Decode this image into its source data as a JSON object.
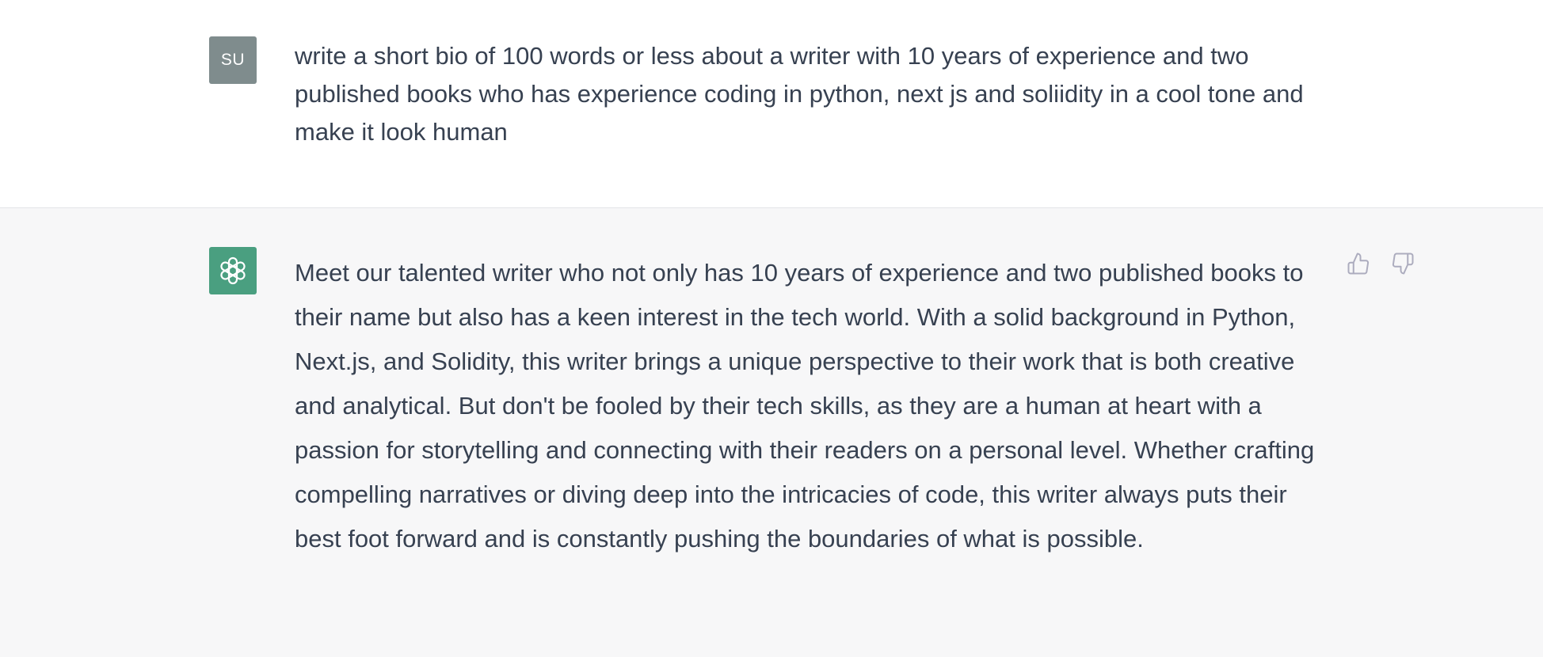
{
  "user_message": {
    "avatar_initials": "SU",
    "avatar_color": "#7f8c8d",
    "text": "write a short bio of 100 words or less about a writer with 10 years of experience and two published books who has experience coding in python, next js and soliidity in a cool tone and make it look human"
  },
  "assistant_message": {
    "avatar_icon": "openai-logo-icon",
    "avatar_color": "#4a9f80",
    "text": "Meet our talented writer who not only has 10 years of experience and two published books to their name but also has a keen interest in the tech world. With a solid background in Python, Next.js, and Solidity, this writer brings a unique perspective to their work that is both creative and analytical. But don't be fooled by their tech skills, as they are a human at heart with a passion for storytelling and connecting with their readers on a personal level. Whether crafting compelling narratives or diving deep into the intricacies of code, this writer always puts their best foot forward and is constantly pushing the boundaries of what is possible.",
    "feedback": {
      "thumbs_up_icon": "thumbs-up-icon",
      "thumbs_down_icon": "thumbs-down-icon"
    }
  }
}
